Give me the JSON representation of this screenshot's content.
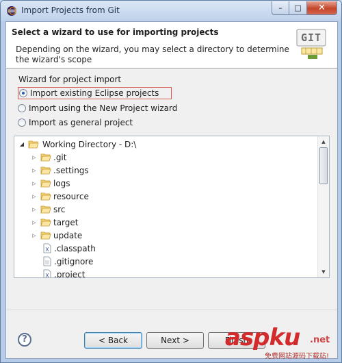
{
  "window": {
    "title": "Import Projects from Git",
    "minimize": "–",
    "maximize": "□",
    "close": "✕"
  },
  "header": {
    "title": "Select a wizard to use for importing projects",
    "description": "Depending on the wizard, you may select a directory to determine the wizard's scope",
    "logo_text": "GIT"
  },
  "group": {
    "label": "Wizard for project import",
    "options": [
      {
        "label": "Import existing Eclipse projects",
        "selected": true
      },
      {
        "label": "Import using the New Project wizard",
        "selected": false
      },
      {
        "label": "Import as general project",
        "selected": false
      }
    ]
  },
  "tree": {
    "root": "Working Directory - D:\\",
    "items": [
      {
        "label": ".git",
        "type": "folder"
      },
      {
        "label": ".settings",
        "type": "folder"
      },
      {
        "label": "logs",
        "type": "folder"
      },
      {
        "label": "resource",
        "type": "folder"
      },
      {
        "label": "src",
        "type": "folder"
      },
      {
        "label": "target",
        "type": "folder"
      },
      {
        "label": "update",
        "type": "folder"
      },
      {
        "label": ".classpath",
        "type": "xfile"
      },
      {
        "label": ".gitignore",
        "type": "file"
      },
      {
        "label": ".project",
        "type": "xfile"
      }
    ]
  },
  "buttons": {
    "help": "?",
    "back": "< Back",
    "next": "Next >",
    "finish": "Finish"
  },
  "watermark": {
    "main": "aspku",
    "net": ".net",
    "sub": "免费网站源码下载站!"
  },
  "colors": {
    "highlight_border": "#d9534f",
    "folder": "#e8b84a",
    "radio_dot": "#2c5ca8"
  }
}
